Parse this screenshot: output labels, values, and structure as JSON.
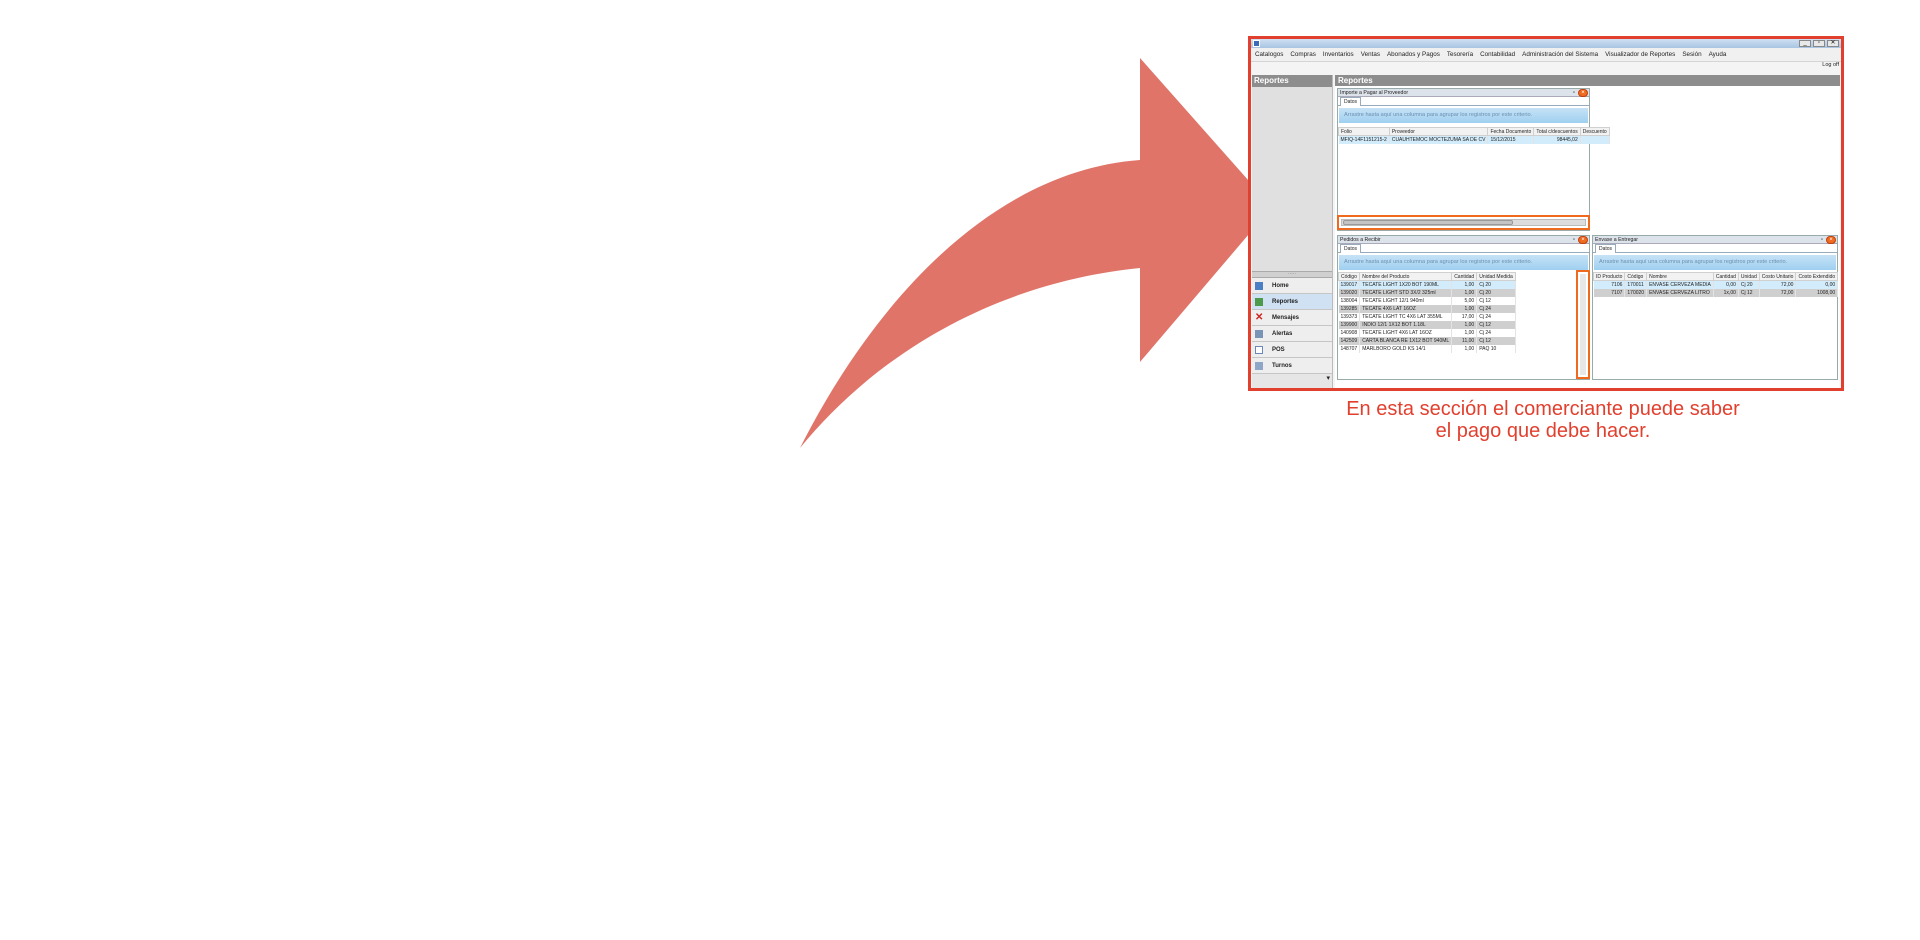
{
  "colors": {
    "arrow": "#e07468",
    "frame": "#e2402f",
    "highlight": "#ee6a1f",
    "caption": "#e2402f"
  },
  "window": {
    "icon": "app-icon",
    "controls": [
      "_",
      "▫",
      "✕"
    ]
  },
  "menu": [
    "Catalogos",
    "Compras",
    "Inventarios",
    "Ventas",
    "Abonados y Pagos",
    "Tesorería",
    "Contabilidad",
    "Administración del Sistema",
    "Visualizador de Reportes",
    "Sesión",
    "Ayuda"
  ],
  "logoff": "Log off",
  "sidebar": {
    "title": "Reportes",
    "items": [
      {
        "label": "Home",
        "icon": "home-icon"
      },
      {
        "label": "Reportes",
        "icon": "reports-icon"
      },
      {
        "label": "Mensajes",
        "icon": "messages-icon"
      },
      {
        "label": "Alertas",
        "icon": "alerts-icon"
      },
      {
        "label": "POS",
        "icon": "pos-icon"
      },
      {
        "label": "Turnos",
        "icon": "shifts-icon"
      }
    ]
  },
  "main": {
    "title": "Reportes",
    "group_hint": "Arrastre hasta aquí una columna para agrupar los registros por este criterio.",
    "tab_label": "Datos",
    "panel_invoices": {
      "title": "Importe a Pagar al Proveedor",
      "columns": [
        "Folio",
        "Proveedor",
        "Fecha Documento",
        "Total c/descuentos",
        "Descuento"
      ],
      "rows": [
        [
          "MFIQ-14F1151215-2",
          "CUAUHTEMOC MOCTEZUMA SA DE CV",
          "15/12/2015",
          "98445,02",
          ""
        ]
      ]
    },
    "panel_orders": {
      "title": "Pedidos a Recibir",
      "columns": [
        "Código",
        "Nombre del Producto",
        "Cantidad",
        "Unidad Medida"
      ],
      "rows": [
        [
          "139017",
          "TECATE LIGHT 1X20 BOT 190ML",
          "1,00",
          "Cj 20"
        ],
        [
          "139020",
          "TECATE LIGHT STD 3X/2 325ml",
          "1,00",
          "Cj 20"
        ],
        [
          "138004",
          "TECATE LIGHT 12/1 940ml",
          "5,00",
          "Cj 12"
        ],
        [
          "139285",
          "TECATE 4X6 LAT 16OZ",
          "1,00",
          "Cj 24"
        ],
        [
          "139373",
          "TECATE LIGHT TC 4X6 LAT 355ML",
          "17,00",
          "Cj 24"
        ],
        [
          "139900",
          "INDIO 12/1 1X12 BOT 1.18L",
          "1,00",
          "Cj 12"
        ],
        [
          "140908",
          "TECATE LIGHT 4X6 LAT 16OZ",
          "1,00",
          "Cj 24"
        ],
        [
          "142509",
          "CARTA BLANCA RE 1X12 BOT 940ML",
          "11,00",
          "Cj 12"
        ],
        [
          "148707",
          "MARLBORO GOLD KS 14/1",
          "1,00",
          "PAQ 10"
        ]
      ]
    },
    "panel_containers": {
      "title": "Envase a Entregar",
      "columns": [
        "ID Producto",
        "Código",
        "Nombre",
        "Cantidad",
        "Unidad",
        "Costo Unitario",
        "Costo Extendido"
      ],
      "rows": [
        [
          "7106",
          "170011",
          "ENVASE CERVEZA MEDIA",
          "0,00",
          "Cj 20",
          "72,00",
          "0,00"
        ],
        [
          "7107",
          "170020",
          "ENVASE CERVEZA LITRO",
          "1x,00",
          "Cj 12",
          "72,00",
          "1008,00"
        ]
      ]
    }
  },
  "caption": {
    "line1": "En esta sección el comerciante puede saber",
    "line2": "el pago que debe hacer."
  }
}
